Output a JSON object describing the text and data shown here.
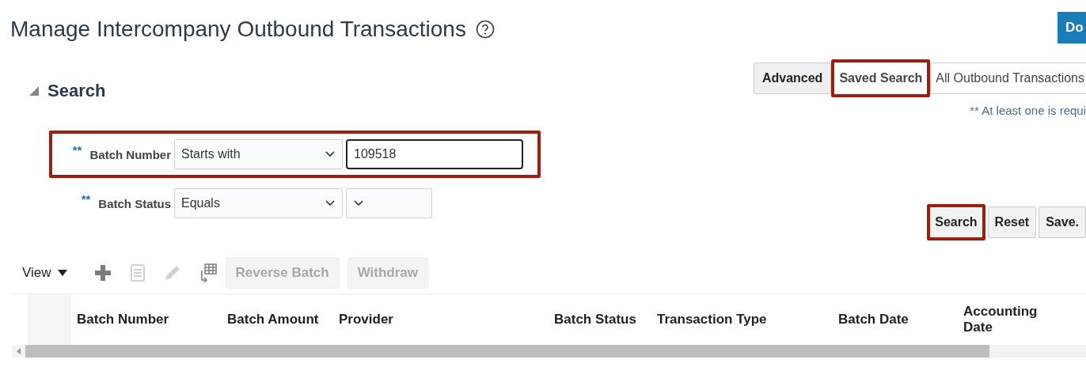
{
  "page": {
    "title": "Manage Intercompany Outbound Transactions",
    "primary_button": "Do"
  },
  "search": {
    "title": "Search",
    "expanded": true,
    "criteria": [
      {
        "required_mark": "**",
        "label": "Batch Number",
        "operator": "Starts with",
        "value": "109518",
        "kind": "text",
        "highlighted": true
      },
      {
        "required_mark": "**",
        "label": "Batch Status",
        "operator": "Equals",
        "kind": "select",
        "highlighted": false
      }
    ],
    "mode_buttons": [
      {
        "label": "Advanced",
        "highlighted": false
      },
      {
        "label": "Saved Search",
        "highlighted": true
      }
    ],
    "saved_search": "All Outbound Transactions",
    "note": "** At least one is requi",
    "actions": [
      {
        "label": "Search",
        "highlighted": true
      },
      {
        "label": "Reset",
        "highlighted": false
      },
      {
        "label": "Save.",
        "highlighted": false
      }
    ]
  },
  "toolbar": {
    "view": "View",
    "icons": [
      {
        "kind": "add",
        "disabled": false
      },
      {
        "kind": "details",
        "disabled": true
      },
      {
        "kind": "edit",
        "disabled": true
      },
      {
        "kind": "freeze",
        "disabled": false
      }
    ],
    "buttons": [
      {
        "label": "Reverse Batch",
        "disabled": true
      },
      {
        "label": "Withdraw",
        "disabled": true
      }
    ]
  },
  "table": {
    "columns": [
      "Batch Number",
      "Batch Amount",
      "Provider",
      "Batch Status",
      "Transaction Type",
      "Batch Date",
      "Accounting Date"
    ]
  }
}
